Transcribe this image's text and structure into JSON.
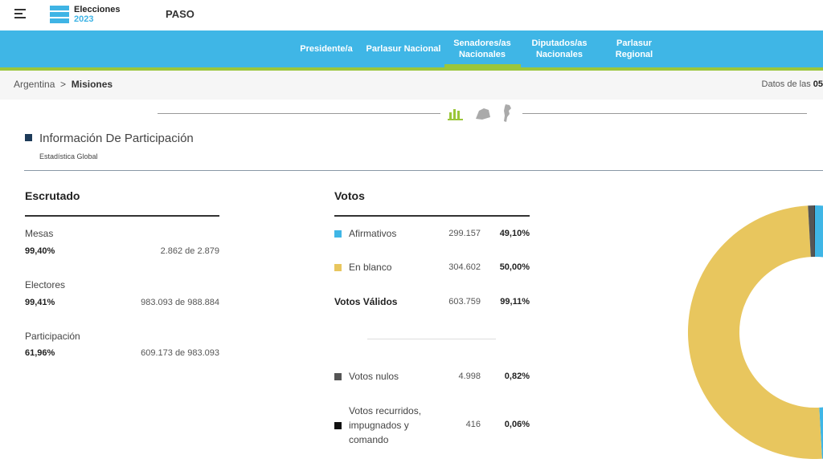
{
  "header": {
    "logo_line1": "Elecciones",
    "logo_line2": "2023",
    "election_type": "PASO"
  },
  "nav": {
    "items": [
      {
        "label": "Presidente/a",
        "active": false
      },
      {
        "label": "Parlasur Nacional",
        "active": false
      },
      {
        "label": "Senadores/as Nacionales",
        "active": true
      },
      {
        "label": "Diputados/as Nacionales",
        "active": false
      },
      {
        "label": "Parlasur Regional",
        "active": false
      }
    ]
  },
  "breadcrumb": {
    "root": "Argentina",
    "separator": ">",
    "current": "Misiones"
  },
  "datos": {
    "prefix": "Datos de las ",
    "time": "05"
  },
  "view_icons": [
    "bar-chart-icon",
    "map-region-icon",
    "map-country-icon"
  ],
  "section": {
    "title": "Información De Participación",
    "subtitle": "Estadística Global"
  },
  "escrutado": {
    "title": "Escrutado",
    "rows": [
      {
        "label": "Mesas",
        "pct": "99,40%",
        "value": "2.862 de 2.879"
      },
      {
        "label": "Electores",
        "pct": "99,41%",
        "value": "983.093 de 988.884"
      },
      {
        "label": "Participación",
        "pct": "61,96%",
        "value": "609.173 de 983.093"
      }
    ]
  },
  "votos": {
    "title": "Votos",
    "rows": [
      {
        "label": "Afirmativos",
        "value": "299.157",
        "pct": "49,10%",
        "color": "#3fb6e6"
      },
      {
        "label": "En blanco",
        "value": "304.602",
        "pct": "50,00%",
        "color": "#e8c65e"
      }
    ],
    "validos": {
      "label": "Votos Válidos",
      "value": "603.759",
      "pct": "99,11%"
    },
    "other_rows": [
      {
        "label": "Votos nulos",
        "value": "4.998",
        "pct": "0,82%",
        "color": "#555555"
      },
      {
        "label": "Votos recurridos, impugnados y comando",
        "value": "416",
        "pct": "0,06%",
        "color": "#111111"
      }
    ]
  },
  "chart_data": {
    "type": "pie",
    "categories": [
      "Afirmativos",
      "En blanco",
      "Votos nulos",
      "Votos recurridos, impugnados y comando"
    ],
    "values": [
      49.1,
      50.0,
      0.82,
      0.06
    ],
    "colors": [
      "#3fb6e6",
      "#e8c65e",
      "#555555",
      "#111111"
    ]
  }
}
